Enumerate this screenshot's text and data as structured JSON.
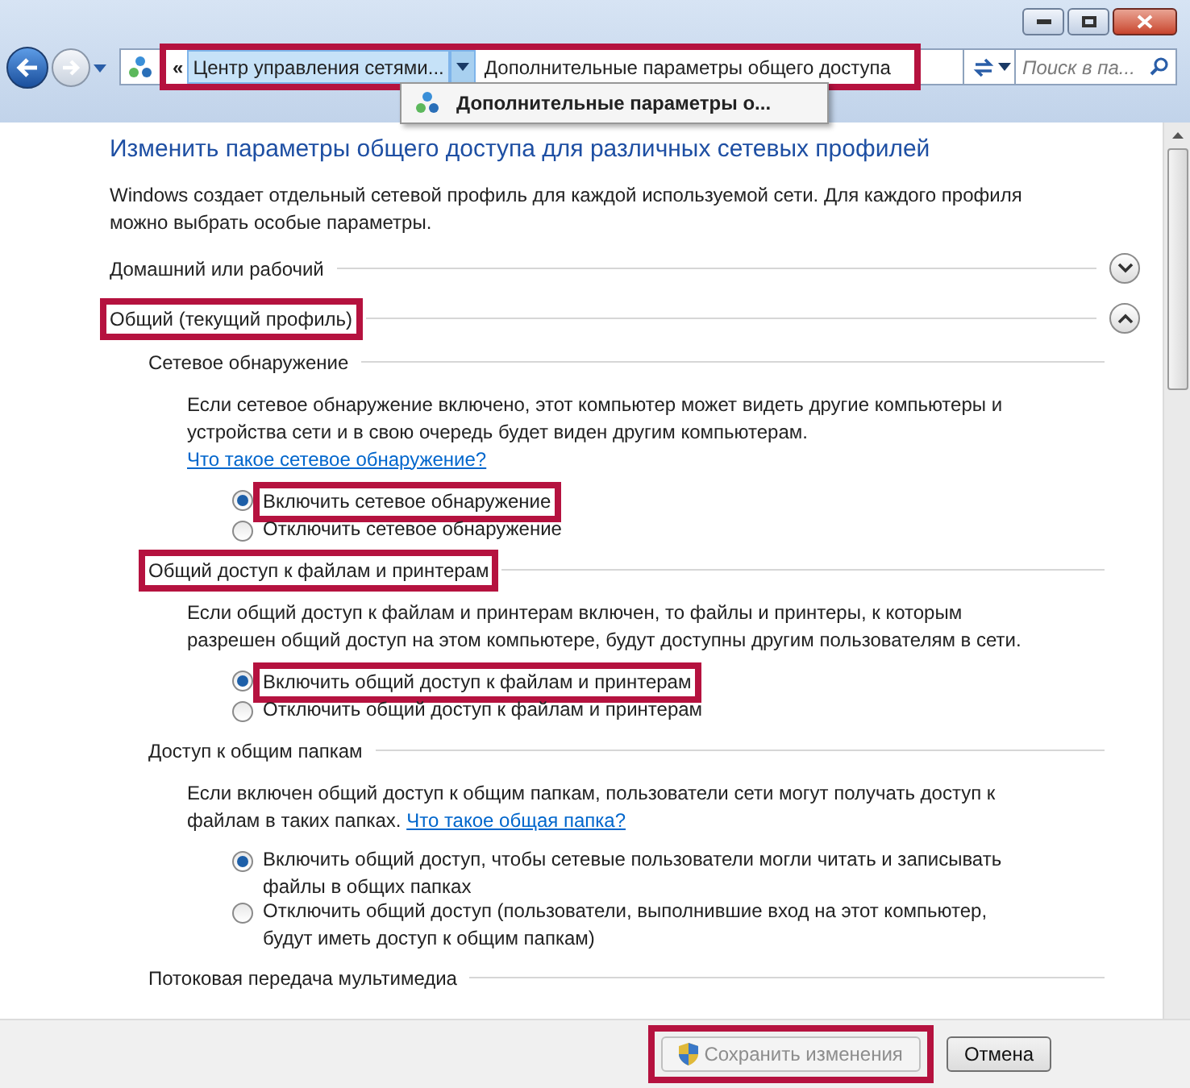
{
  "address_bar": {
    "breadcrumb_overflow": "«",
    "breadcrumb": "Центр управления сетями...",
    "current": "Дополнительные параметры общего доступа",
    "highlighted": true
  },
  "breadcrumb_menu": {
    "items": [
      {
        "label": "Дополнительные параметры о...",
        "selected": true
      }
    ]
  },
  "search": {
    "placeholder": "Поиск в па..."
  },
  "heading": "Изменить параметры общего доступа для различных сетевых профилей",
  "intro": "Windows создает отдельный сетевой профиль для каждой используемой сети. Для каждого профиля можно выбрать особые параметры.",
  "profiles": [
    {
      "label": "Домашний или рабочий",
      "expanded": false,
      "highlighted": false
    },
    {
      "label": "Общий (текущий профиль)",
      "expanded": true,
      "highlighted": true,
      "sections": [
        {
          "title": "Сетевое обнаружение",
          "highlighted": false,
          "description": "Если сетевое обнаружение включено, этот компьютер может видеть другие компьютеры и устройства сети и в свою очередь будет виден другим компьютерам.",
          "link": "Что такое сетевое обнаружение?",
          "options": [
            {
              "label": "Включить сетевое обнаружение",
              "selected": true,
              "highlighted": true
            },
            {
              "label": "Отключить сетевое обнаружение",
              "selected": false,
              "highlighted": false
            }
          ]
        },
        {
          "title": "Общий доступ к файлам и принтерам",
          "highlighted": true,
          "description": "Если общий доступ к файлам и принтерам включен, то файлы и принтеры, к которым разрешен общий доступ на этом компьютере, будут доступны другим пользователям в сети.",
          "options": [
            {
              "label": "Включить общий доступ к файлам и принтерам",
              "selected": true,
              "highlighted": true
            },
            {
              "label": "Отключить общий доступ к файлам и принтерам",
              "selected": false,
              "highlighted": false
            }
          ]
        },
        {
          "title": "Доступ к общим папкам",
          "highlighted": false,
          "description": "Если включен общий доступ к общим папкам, пользователи сети могут получать доступ к файлам в таких папках.",
          "link": "Что такое общая папка?",
          "options": [
            {
              "label": "Включить общий доступ, чтобы сетевые пользователи могли читать и записывать файлы в общих папках",
              "selected": true,
              "highlighted": false
            },
            {
              "label": "Отключить общий доступ (пользователи, выполнившие вход на этот компьютер, будут иметь доступ к общим папкам)",
              "selected": false,
              "highlighted": false
            }
          ]
        },
        {
          "title": "Потоковая передача мультимедиа",
          "highlighted": false
        }
      ]
    }
  ],
  "buttons": [
    {
      "label": "Сохранить изменения",
      "disabled": true,
      "highlighted": true,
      "shield": true
    },
    {
      "label": "Отмена",
      "disabled": false,
      "highlighted": false,
      "shield": false
    }
  ]
}
